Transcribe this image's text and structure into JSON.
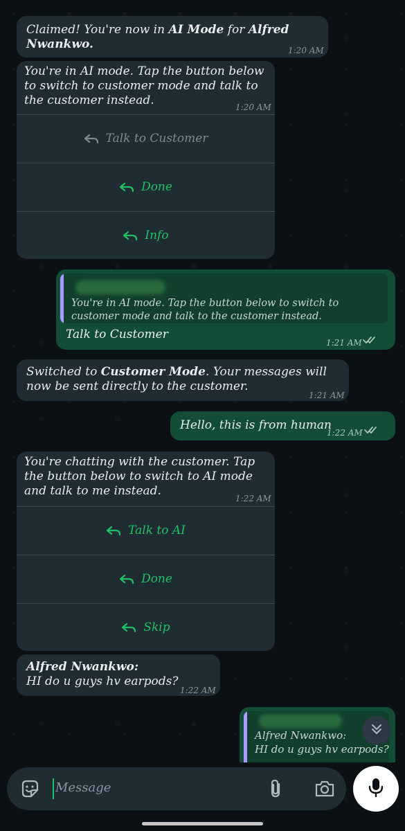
{
  "messages": {
    "m1": {
      "prefix": "Claimed! You're now in ",
      "bold1": "AI Mode",
      "middle": " for ",
      "bold2": "Alfred Nwankwo.",
      "time": "1:20 AM"
    },
    "m2": {
      "text": "You're in AI mode. Tap the button below to switch to customer mode and talk to the customer instead.",
      "time": "1:20 AM",
      "buttons": [
        "Talk to Customer",
        "Done",
        "Info"
      ]
    },
    "m3": {
      "quote_text": "You're in AI mode. Tap the button below to switch to customer mode and talk to the customer instead.",
      "text": "Talk to Customer",
      "time": "1:21 AM"
    },
    "m4": {
      "prefix": "Switched to ",
      "bold": "Customer Mode",
      "suffix": ". Your messages will now be sent directly to the customer.",
      "time": "1:21 AM"
    },
    "m5": {
      "text": "Hello, this is from human",
      "time": "1:22 AM"
    },
    "m6": {
      "text": "You're chatting with the customer. Tap the button below to switch to AI mode and talk to me instead.",
      "time": "1:22 AM",
      "buttons": [
        "Talk to AI",
        "Done",
        "Skip"
      ]
    },
    "m7": {
      "sender": "Alfred Nwankwo:",
      "text": "HI do u guys hv earpods?",
      "time": "1:22 AM"
    },
    "m8": {
      "quote_sender": "Alfred Nwankwo:",
      "quote_text": "HI do u guys hv earpods?"
    }
  },
  "composer": {
    "placeholder": "Message"
  },
  "icons": {
    "emoji": "sticker-icon",
    "attach": "paperclip-icon",
    "camera": "camera-icon",
    "mic": "microphone-icon",
    "scroll": "chevron-double-down-icon"
  },
  "colors": {
    "incoming_bubble": "#202c33",
    "outgoing_bubble": "#144d37",
    "button_text": "#21c063",
    "read_ticks": "#53bdeb"
  }
}
